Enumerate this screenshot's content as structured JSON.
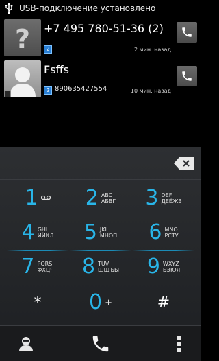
{
  "status_bar": {
    "usb_icon": "usb-icon",
    "notification_text": "USB-подключение установлено"
  },
  "call_log": {
    "entries": [
      {
        "name": "+7 495 780-51-36 (2)",
        "number": "",
        "time": "2 мин. назад",
        "avatar": "unknown-contact-icon",
        "sim_icon": "sim-icon"
      },
      {
        "name": "Fsffs",
        "number": "890635427554",
        "time": "10 мин. назад",
        "avatar": "contact-icon",
        "sim_icon": "sim-icon"
      }
    ]
  },
  "dialpad": {
    "keys": [
      {
        "digit": "1",
        "letters": "",
        "icon": "voicemail-icon"
      },
      {
        "digit": "2",
        "letters": "ABC\nАБВГ"
      },
      {
        "digit": "3",
        "letters": "DEF\nДЕЁЖЗ"
      },
      {
        "digit": "4",
        "letters": "GHI\nИЙКЛ"
      },
      {
        "digit": "5",
        "letters": "JKL\nМНОП"
      },
      {
        "digit": "6",
        "letters": "MNO\nРСТУ"
      },
      {
        "digit": "7",
        "letters": "PQRS\nФХЦЧ"
      },
      {
        "digit": "8",
        "letters": "TUV\nШЩЪЫ"
      },
      {
        "digit": "9",
        "letters": "WXYZ\nЬЭЮЯ"
      },
      {
        "digit": "*",
        "letters": ""
      },
      {
        "digit": "0",
        "letters": "+"
      },
      {
        "digit": "#",
        "letters": ""
      }
    ],
    "accent_color": "#29b5e8"
  },
  "bottom_bar": {
    "contacts_icon": "contacts-icon",
    "call_icon": "phone-icon",
    "menu_icon": "overflow-menu-icon"
  }
}
